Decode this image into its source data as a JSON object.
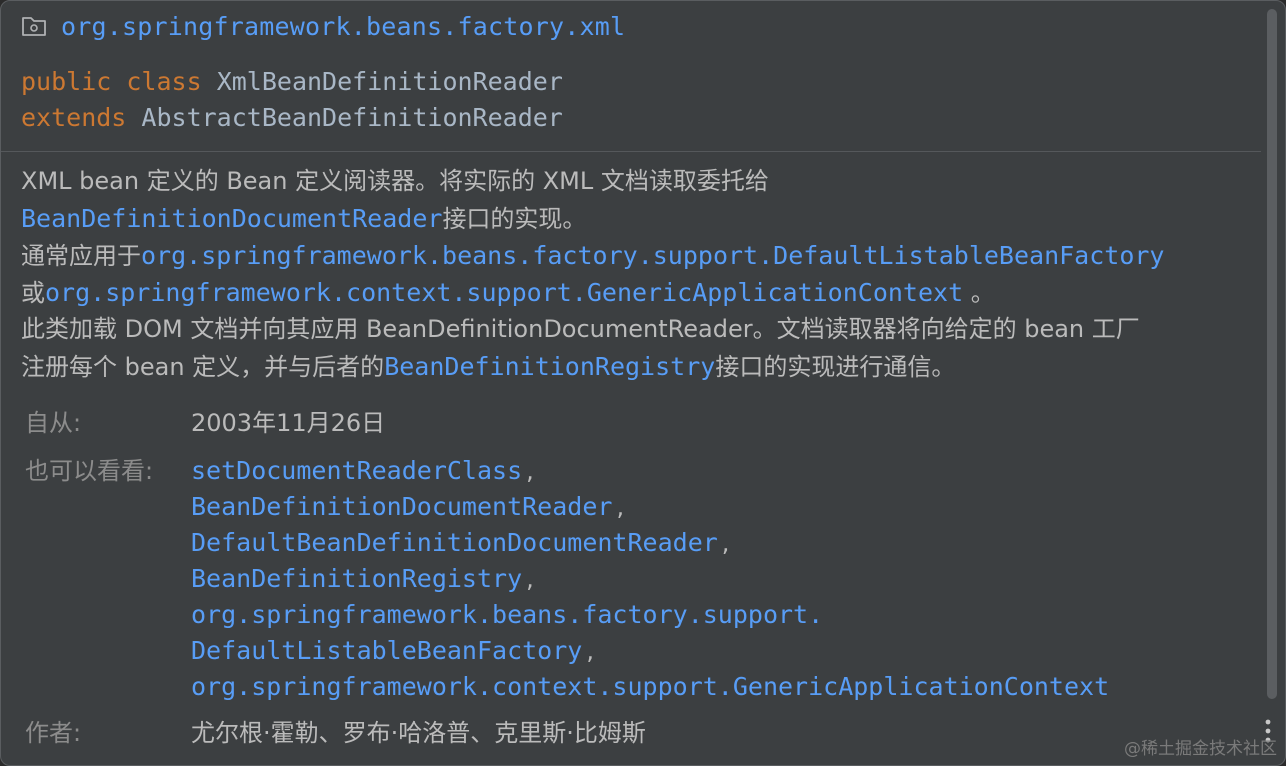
{
  "header": {
    "package_icon": "package-folder-icon",
    "package_name": "org.springframework.beans.factory.xml",
    "signature": {
      "kw_public": "public",
      "kw_class": "class",
      "class_name": "XmlBeanDefinitionReader",
      "kw_extends": "extends",
      "super_name": "AbstractBeanDefinitionReader"
    }
  },
  "description": {
    "line1": "XML bean 定义的 Bean 定义阅读器。将实际的 XML 文档读取委托给",
    "line2_link": "BeanDefinitionDocumentReader",
    "line2_text": "接口的实现。",
    "line3_text": "通常应用于",
    "line3_link": "org.springframework.beans.factory.support.DefaultListableBeanFactory",
    "line4_text": "或",
    "line4_link": "org.springframework.context.support.GenericApplicationContext",
    "line4_end": " 。",
    "line5": "此类加载 DOM 文档并向其应用 BeanDefinitionDocumentReader。文档读取器将向给定的 bean 工厂",
    "line6_text": "注册每个 bean 定义，并与后者的",
    "line6_link": "BeanDefinitionRegistry",
    "line6_end": "接口的实现进行通信。"
  },
  "tags": {
    "since_label": "自从:",
    "since_value": "2003年11月26日",
    "see_label": "也可以看看:",
    "see_items": [
      {
        "text": "setDocumentReaderClass",
        "sep": ","
      },
      {
        "text": "BeanDefinitionDocumentReader",
        "sep": ","
      },
      {
        "text": "DefaultBeanDefinitionDocumentReader",
        "sep": ","
      },
      {
        "text": "BeanDefinitionRegistry",
        "sep": ","
      },
      {
        "text": "org.springframework.beans.factory.support.",
        "sep": ""
      },
      {
        "text": "DefaultListableBeanFactory",
        "sep": ","
      },
      {
        "text": "org.springframework.context.support.GenericApplicationContext",
        "sep": ""
      }
    ],
    "author_label": "作者:",
    "author_value": "尤尔根·霍勒、罗布·哈洛普、克里斯·比姆斯"
  },
  "watermark": "@稀土掘金技术社区",
  "colors": {
    "background": "#3c3f41",
    "link": "#589df6",
    "keyword": "#cc7832",
    "text": "#bbbbbb",
    "label": "#8c8c8c"
  }
}
